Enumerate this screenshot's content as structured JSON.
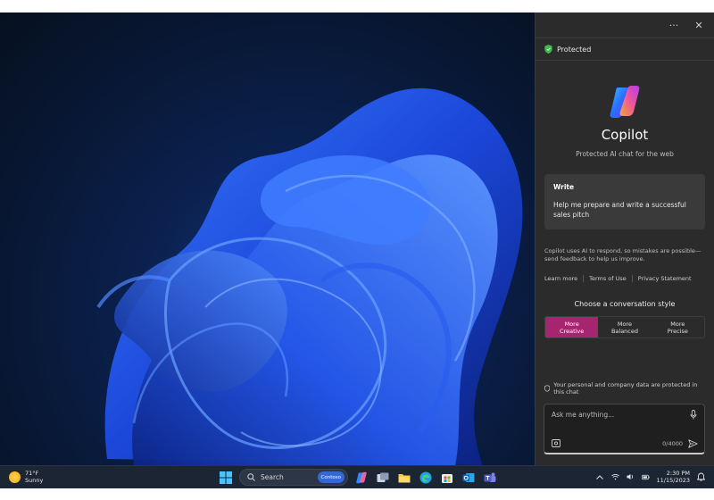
{
  "window": {
    "more_label": "···",
    "close_label": "✕"
  },
  "panel": {
    "protected_label": "Protected",
    "title": "Copilot",
    "subtitle": "Protected AI chat for the web",
    "card": {
      "title": "Write",
      "text": "Help me prepare and write a successful sales pitch"
    },
    "disclaimer": "Copilot uses AI to respond, so mistakes are possible—send feedback to help us improve.",
    "links": [
      "Learn more",
      "Terms of Use",
      "Privacy Statement"
    ],
    "style_label": "Choose a conversation style",
    "styles": [
      {
        "line1": "More",
        "line2": "Creative",
        "active": true
      },
      {
        "line1": "More",
        "line2": "Balanced",
        "active": false
      },
      {
        "line1": "More",
        "line2": "Precise",
        "active": false
      }
    ],
    "privacy_note": "Your personal and company data are protected in this chat",
    "input": {
      "placeholder": "Ask me anything...",
      "counter": "0/4000"
    },
    "colors": {
      "accent": "#a5266f",
      "shield": "#3fb950",
      "panel_bg": "#2b2b2b"
    }
  },
  "taskbar": {
    "weather": {
      "temp": "71°F",
      "condition": "Sunny",
      "icon": "sun-icon"
    },
    "search": {
      "label": "Search",
      "pill": "Contoso"
    },
    "apps": [
      "start-icon",
      "search",
      "copilot-icon",
      "task-view-icon",
      "file-explorer-icon",
      "edge-icon",
      "store-icon",
      "outlook-icon",
      "teams-icon"
    ],
    "clock": {
      "time": "2:30 PM",
      "date": "11/15/2023"
    },
    "tray_icons": [
      "chevron-up-icon",
      "wifi-icon",
      "volume-icon",
      "battery-icon",
      "notification-bell-icon"
    ]
  }
}
